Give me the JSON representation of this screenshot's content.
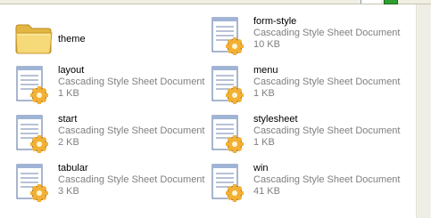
{
  "files": [
    {
      "name": "theme",
      "kind": "folder",
      "type": "",
      "size": ""
    },
    {
      "name": "form-style",
      "kind": "css",
      "type": "Cascading Style Sheet Document",
      "size": "10 KB"
    },
    {
      "name": "layout",
      "kind": "css",
      "type": "Cascading Style Sheet Document",
      "size": "1 KB"
    },
    {
      "name": "menu",
      "kind": "css",
      "type": "Cascading Style Sheet Document",
      "size": "1 KB"
    },
    {
      "name": "start",
      "kind": "css",
      "type": "Cascading Style Sheet Document",
      "size": "2 KB"
    },
    {
      "name": "stylesheet",
      "kind": "css",
      "type": "Cascading Style Sheet Document",
      "size": "1 KB"
    },
    {
      "name": "tabular",
      "kind": "css",
      "type": "Cascading Style Sheet Document",
      "size": "3 KB"
    },
    {
      "name": "win",
      "kind": "css",
      "type": "Cascading Style Sheet Document",
      "size": "41 KB"
    }
  ],
  "icons": {
    "folder": "folder-icon",
    "css": "css-document-icon"
  },
  "colors": {
    "background": "#ffffff",
    "secondary_text": "#7f7f7f",
    "folder": "#f3d36b",
    "gear": "#f2b134"
  }
}
